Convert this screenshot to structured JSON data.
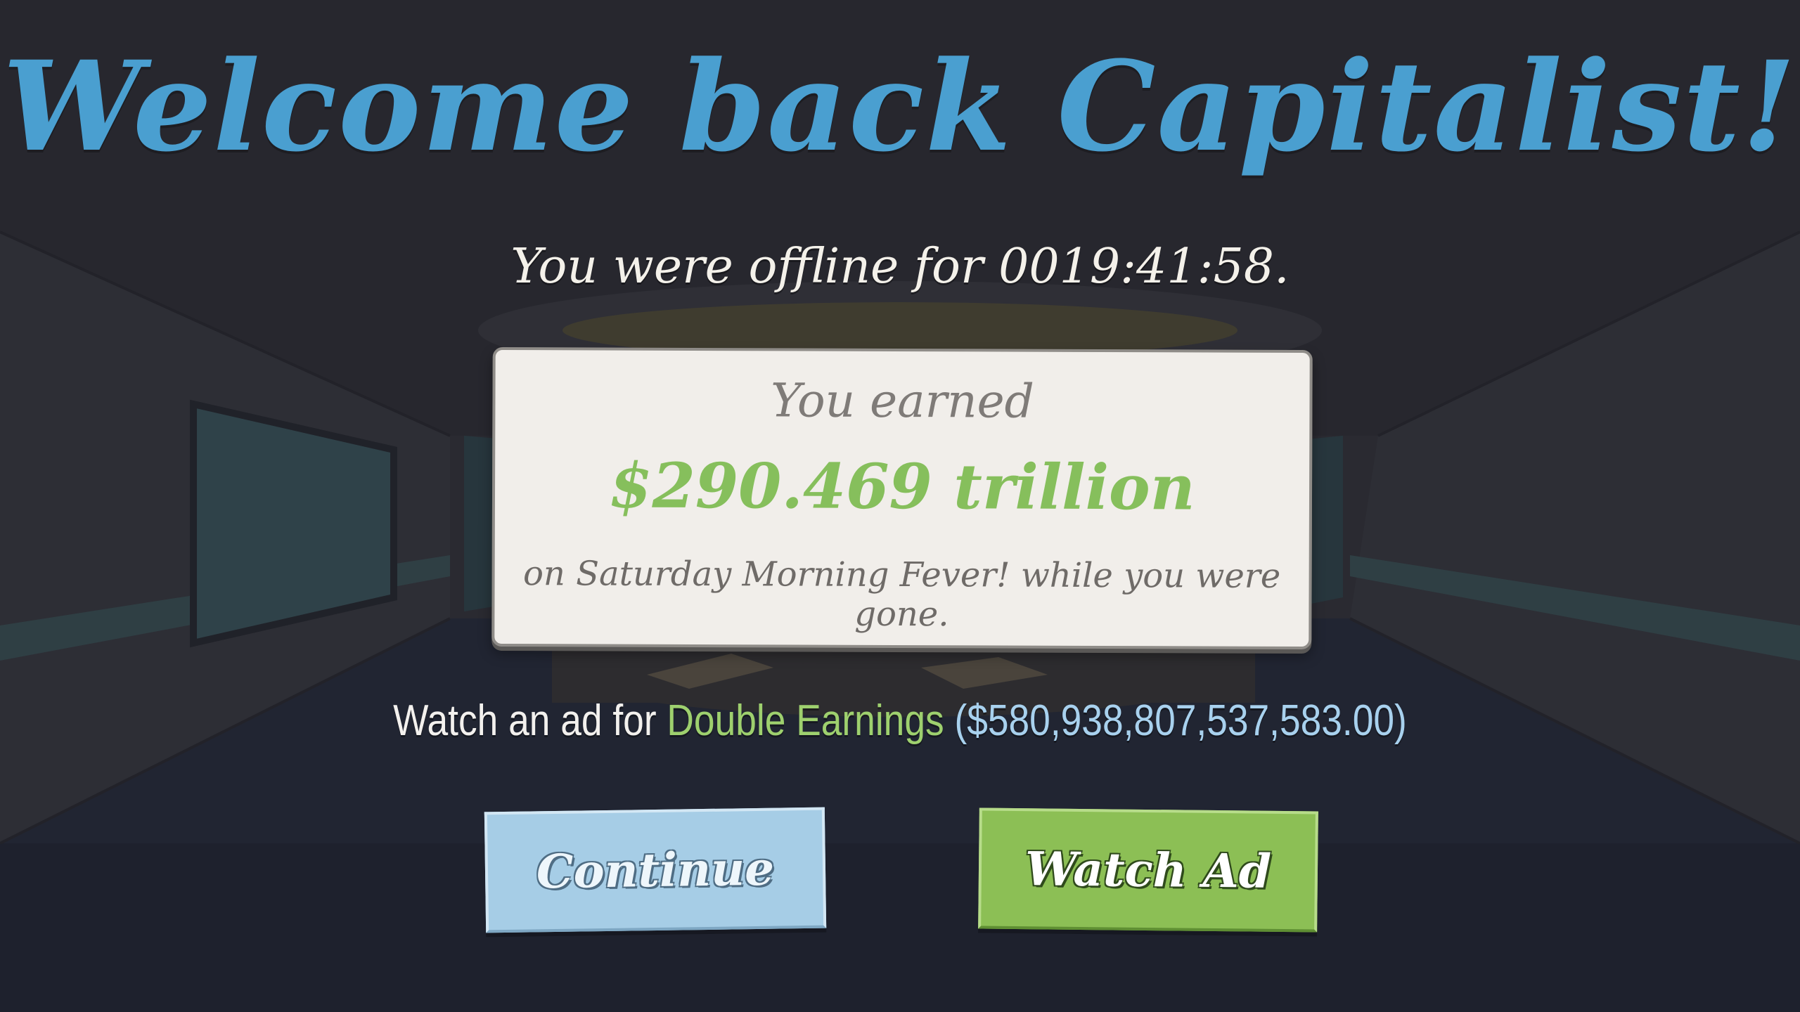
{
  "title": "Welcome back Capitalist!",
  "offline_text": "You were offline for 0019:41:58.",
  "card": {
    "line1": "You earned",
    "amount": "$290.469 trillion",
    "line3": "on Saturday Morning Fever! while you were gone."
  },
  "ad_offer": {
    "prefix": "Watch an ad for ",
    "highlight": "Double Earnings",
    "amount": " ($580,938,807,537,583.00)"
  },
  "buttons": {
    "continue_label": "Continue",
    "watch_ad_label": "Watch Ad"
  },
  "colors": {
    "title": "#4a9fd0",
    "amount": "#86bf5c",
    "continue_button": "#a6cde6",
    "watch_button": "#8cbf55"
  }
}
